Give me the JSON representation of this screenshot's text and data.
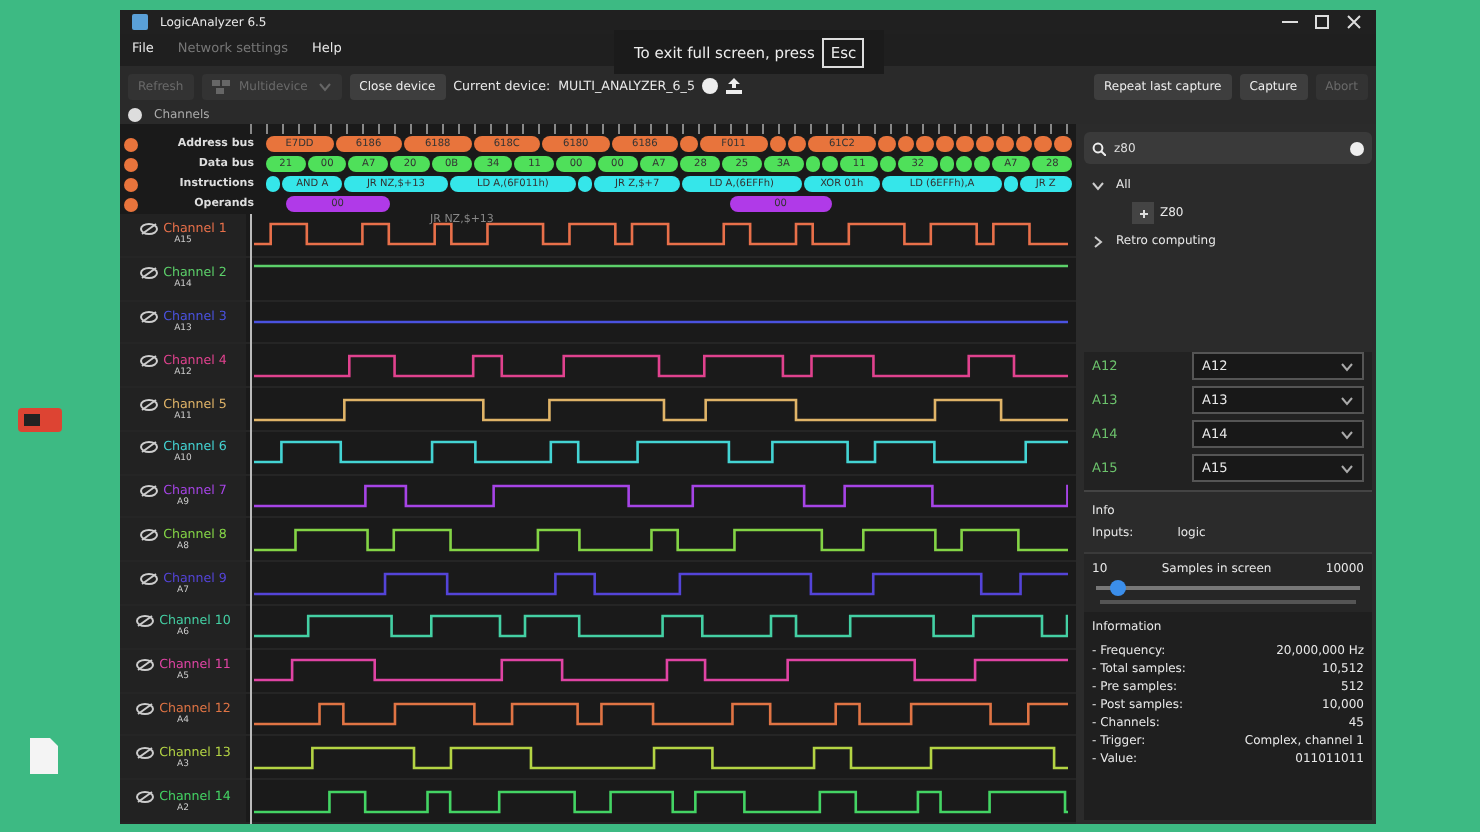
{
  "window": {
    "title": "LogicAnalyzer 6.5"
  },
  "menu": [
    {
      "label": "File",
      "disabled": false
    },
    {
      "label": "Network settings",
      "disabled": true
    },
    {
      "label": "Help",
      "disabled": false
    }
  ],
  "fullscreen_notice": {
    "text": "To exit full screen, press",
    "key": "Esc"
  },
  "toolbar": {
    "refresh": {
      "label": "Refresh",
      "disabled": true
    },
    "multidevice": {
      "label": "Multidevice",
      "disabled": true
    },
    "close": {
      "label": "Close device",
      "disabled": false
    },
    "device_label": "Current device:",
    "device": "MULTI_ANALYZER_6_5",
    "right_buttons": [
      {
        "label": "Repeat last capture",
        "disabled": false
      },
      {
        "label": "Capture",
        "disabled": false
      },
      {
        "label": "Abort",
        "disabled": true
      }
    ]
  },
  "channels_header": "Channels",
  "buses": [
    {
      "name": "Address bus",
      "color": "#e8743c",
      "segments": [
        {
          "text": "E7DD"
        },
        {
          "text": "6186"
        },
        {
          "text": "6188"
        },
        {
          "text": "618C"
        },
        {
          "text": "6180"
        },
        {
          "text": "6186"
        },
        {
          "kind": "blank"
        },
        {
          "text": "F011"
        },
        {
          "kind": "blank"
        },
        {
          "kind": "blank"
        },
        {
          "text": "61C2"
        },
        {
          "kind": "blank"
        },
        {
          "kind": "blank"
        },
        {
          "kind": "blank"
        },
        {
          "kind": "blank"
        },
        {
          "kind": "blank"
        },
        {
          "kind": "blank"
        },
        {
          "kind": "blank"
        },
        {
          "kind": "blank"
        },
        {
          "kind": "blank"
        },
        {
          "kind": "blank"
        }
      ]
    },
    {
      "name": "Data bus",
      "color": "#4fe05a",
      "segments": [
        {
          "text": "21"
        },
        {
          "text": "00"
        },
        {
          "text": "A7"
        },
        {
          "text": "20"
        },
        {
          "text": "0B"
        },
        {
          "text": "34"
        },
        {
          "text": "11"
        },
        {
          "text": "00"
        },
        {
          "text": "00"
        },
        {
          "text": "A7"
        },
        {
          "text": "28"
        },
        {
          "text": "25"
        },
        {
          "text": "3A"
        },
        {
          "kind": "blank"
        },
        {
          "kind": "blank"
        },
        {
          "text": "11"
        },
        {
          "kind": "blank"
        },
        {
          "text": "32"
        },
        {
          "kind": "blank"
        },
        {
          "kind": "blank"
        },
        {
          "kind": "blank"
        },
        {
          "text": "A7"
        },
        {
          "text": "28"
        }
      ]
    },
    {
      "name": "Instructions",
      "color": "#35e6ea",
      "segments": [
        {
          "kind": "blank"
        },
        {
          "text": "AND A"
        },
        {
          "text": "JR NZ,$+13"
        },
        {
          "text": "LD A,(6F011h)"
        },
        {
          "kind": "blank"
        },
        {
          "text": "JR Z,$+7"
        },
        {
          "text": "LD A,(6EFFh)"
        },
        {
          "text": "XOR 01h"
        },
        {
          "text": "LD (6EFFh),A"
        },
        {
          "kind": "blank"
        },
        {
          "text": "JR Z"
        }
      ]
    },
    {
      "name": "Operands",
      "color": "#b03ae8",
      "segments": [
        {
          "text": "00"
        },
        {
          "text": "00"
        }
      ]
    }
  ],
  "tooltip": "JR NZ,$+13",
  "channels": [
    {
      "name": "Channel 1",
      "pin": "A15",
      "color": "#e8704a"
    },
    {
      "name": "Channel 2",
      "pin": "A14",
      "color": "#5cd06a"
    },
    {
      "name": "Channel 3",
      "pin": "A13",
      "color": "#4a52e0"
    },
    {
      "name": "Channel 4",
      "pin": "A12",
      "color": "#e0428e"
    },
    {
      "name": "Channel 5",
      "pin": "A11",
      "color": "#e0b468"
    },
    {
      "name": "Channel 6",
      "pin": "A10",
      "color": "#44d4d4"
    },
    {
      "name": "Channel 7",
      "pin": "A9",
      "color": "#a644e6"
    },
    {
      "name": "Channel 8",
      "pin": "A8",
      "color": "#84d446"
    },
    {
      "name": "Channel 9",
      "pin": "A7",
      "color": "#5444d8"
    },
    {
      "name": "Channel 10",
      "pin": "A6",
      "color": "#44d0a4"
    },
    {
      "name": "Channel 11",
      "pin": "A5",
      "color": "#e044a4"
    },
    {
      "name": "Channel 12",
      "pin": "A4",
      "color": "#e07444"
    },
    {
      "name": "Channel 13",
      "pin": "A3",
      "color": "#b4d444"
    },
    {
      "name": "Channel 14",
      "pin": "A2",
      "color": "#44d464"
    }
  ],
  "search": {
    "value": "z80"
  },
  "tree": [
    {
      "label": "All",
      "expanded": true,
      "children": [
        {
          "label": "Z80"
        }
      ]
    },
    {
      "label": "Retro computing",
      "expanded": false
    }
  ],
  "mappings": [
    {
      "label": "A12",
      "value": "A12"
    },
    {
      "label": "A13",
      "value": "A13"
    },
    {
      "label": "A14",
      "value": "A14"
    },
    {
      "label": "A15",
      "value": "A15"
    }
  ],
  "info": {
    "title": "Info",
    "key": "Inputs:",
    "value": "logic"
  },
  "samples": {
    "min": "10",
    "label": "Samples in screen",
    "max": "10000",
    "level": 0.08
  },
  "information": {
    "title": "Information",
    "rows": [
      {
        "key": "- Frequency:",
        "value": "20,000,000 Hz"
      },
      {
        "key": "- Total samples:",
        "value": "10,512"
      },
      {
        "key": "- Pre samples:",
        "value": "512"
      },
      {
        "key": "- Post samples:",
        "value": "10,000"
      },
      {
        "key": "- Channels:",
        "value": "45"
      },
      {
        "key": "- Trigger:",
        "value": "Complex, channel 1"
      },
      {
        "key": "- Value:",
        "value": "011011011"
      }
    ]
  }
}
